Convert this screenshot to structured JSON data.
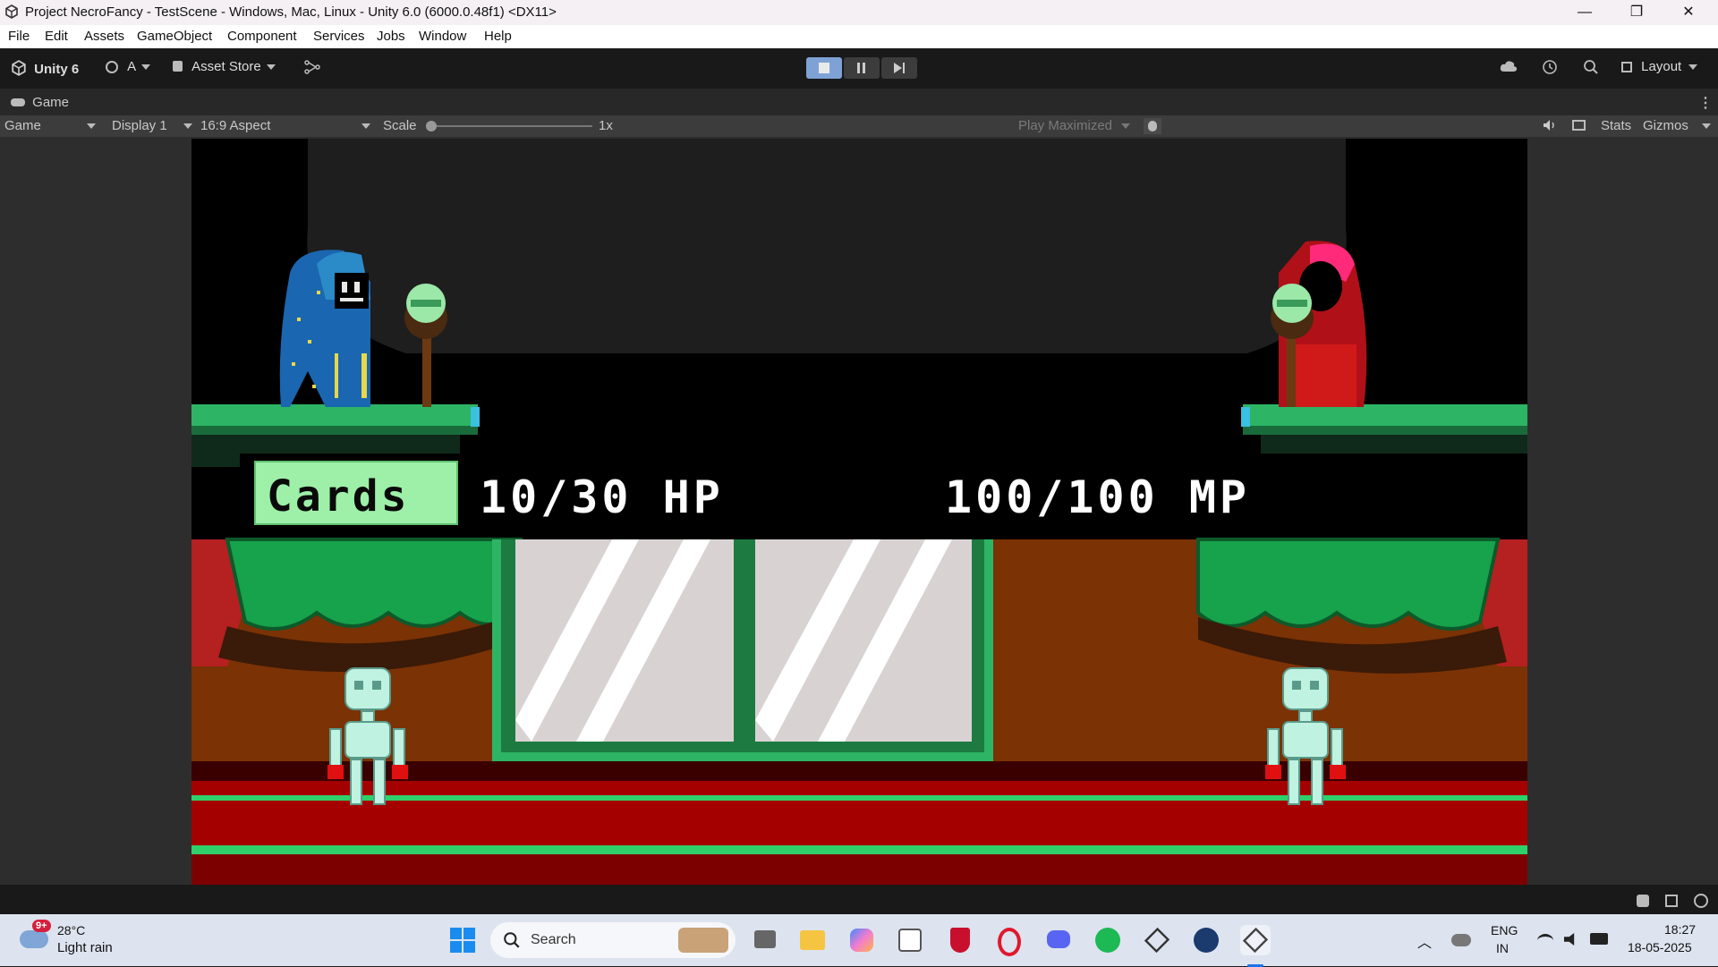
{
  "window": {
    "title": "Project NecroFancy - TestScene - Windows, Mac, Linux - Unity 6.0 (6000.0.48f1) <DX11>",
    "minimize": "—",
    "maximize": "❐",
    "close": "✕"
  },
  "menu": [
    "File",
    "Edit",
    "Assets",
    "GameObject",
    "Component",
    "Services",
    "Jobs",
    "Window",
    "Help"
  ],
  "toolbar": {
    "unity_label": "Unity 6",
    "account_label": "A",
    "asset_store_label": "Asset Store",
    "layout_label": "Layout"
  },
  "tab": {
    "label": "Game"
  },
  "gamebar": {
    "view_select": "Game",
    "display_select": "Display 1",
    "aspect_select": "16:9 Aspect",
    "scale_label": "Scale",
    "scale_value": "1x",
    "play_mode": "Play Maximized",
    "stats_label": "Stats",
    "gizmos_label": "Gizmos"
  },
  "game": {
    "cards_button": "Cards",
    "hp_text": "10/30 HP",
    "mp_text": "100/100 MP"
  },
  "taskbar": {
    "weather_temp": "28°C",
    "weather_desc": "Light rain",
    "weather_badge": "9+",
    "search_label": "Search",
    "lang_top": "ENG",
    "lang_bottom": "IN",
    "time": "18:27",
    "date": "18-05-2025"
  }
}
